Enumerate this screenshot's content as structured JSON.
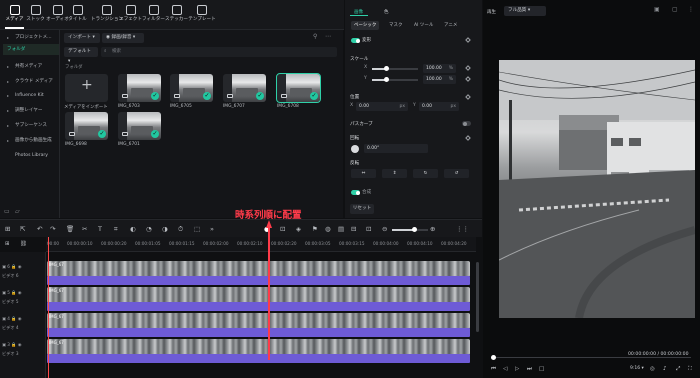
{
  "toolbar": {
    "items": [
      {
        "label": "メディア",
        "icon": "media-icon"
      },
      {
        "label": "ストック",
        "icon": "stock-icon"
      },
      {
        "label": "オーディオ",
        "icon": "audio-icon"
      },
      {
        "label": "タイトル",
        "icon": "title-icon"
      },
      {
        "label": "トランジション",
        "icon": "transition-icon"
      },
      {
        "label": "エフェクト",
        "icon": "effect-icon"
      },
      {
        "label": "フィルター",
        "icon": "filter-icon"
      },
      {
        "label": "ステッカー",
        "icon": "sticker-icon"
      },
      {
        "label": "テンプレート",
        "icon": "template-icon"
      }
    ]
  },
  "sidebar": {
    "items": [
      "プロジェクトメ...",
      "フォルダ",
      "共有メディア",
      "クラウド メディア",
      "Influence Kit",
      "調整レイヤー",
      "サブシーケンス",
      "画像から動画生成",
      "Photos Library"
    ]
  },
  "media": {
    "import_label": "インポート",
    "record_label": "録画/録音",
    "sort_label": "デフォルト",
    "search_placeholder": "検索",
    "folder_label": "フォルダ",
    "import_tile_label": "メディアをインポート",
    "thumbs": [
      "IMG_6703",
      "IMG_6705",
      "IMG_6707",
      "IMG_6708",
      "IMG_6698",
      "IMG_6701"
    ]
  },
  "props": {
    "tabs": [
      "画像",
      "色"
    ],
    "subtabs": [
      "ベーシック",
      "マスク",
      "AI ツール",
      "アニメ"
    ],
    "transform_label": "変形",
    "scale_label": "スケール",
    "x_label": "X",
    "y_label": "Y",
    "scale_x": "100.00",
    "scale_y": "100.00",
    "percent": "%",
    "position_label": "位置",
    "pos_x": "0.00",
    "pos_y": "0.00",
    "px": "px",
    "path_curve_label": "パスカーブ",
    "rotate_label": "回転",
    "rotate_value": "0.00°",
    "flip_label": "反転",
    "composite_label": "合成",
    "reset_label": "リセット"
  },
  "preview": {
    "player_label": "再生",
    "quality_label": "フル品質",
    "time_current": "00:00:00:00",
    "time_total": "00:00:00:00"
  },
  "timeline": {
    "ticks": [
      "00:00",
      "00:00:00:10",
      "00:00:00:20",
      "00:00:01:05",
      "00:00:01:15",
      "00:00:02:00",
      "00:00:02:10",
      "00:00:02:20",
      "00:00:03:05",
      "00:00:03:15",
      "00:00:04:00",
      "00:00:04:10",
      "00:00:04:20"
    ],
    "tracks": [
      "ビデオ 6",
      "ビデオ 5",
      "ビデオ 4",
      "ビデオ 3"
    ],
    "clip_label": "IMG_67",
    "annotation": "時系列順に配置"
  },
  "colors": {
    "accent": "#2fd0a8",
    "annotation": "#ff3b4a",
    "audio": "#6e5bd6"
  }
}
